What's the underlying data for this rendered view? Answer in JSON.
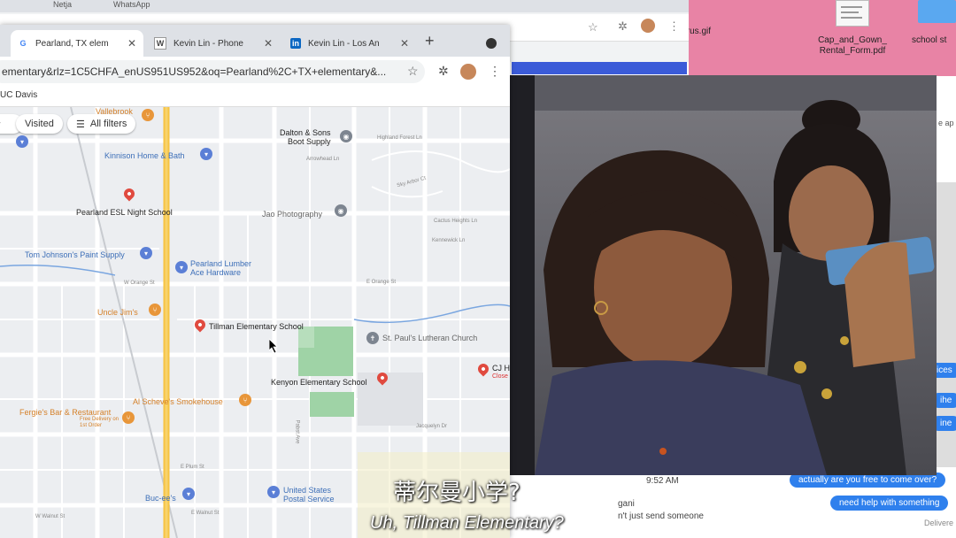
{
  "desktop": {
    "icons": [
      {
        "label_line1": "Cap_and_Gown_",
        "label_line2": "Rental_Form.pdf"
      },
      {
        "label_line1": "school st"
      }
    ],
    "fragment_gif": "airus.gif",
    "pink_color": "#e883a5"
  },
  "back_window": {
    "tabs": [
      "Netja",
      "WhatsApp"
    ],
    "side_text_1": "ne",
    "side_text_2": "e ap"
  },
  "browser": {
    "tabs": [
      {
        "icon": "google-icon",
        "label": "Pearland, TX elem"
      },
      {
        "icon": "w-icon",
        "label": "Kevin Lin - Phone"
      },
      {
        "icon": "linkedin-icon",
        "label": "Kevin Lin - Los An"
      }
    ],
    "new_tab": "+",
    "url": "ementary&rlz=1C5CHFA_enUS951US952&oq=Pearland%2C+TX+elementary&...",
    "bookmark": "UC Davis"
  },
  "map": {
    "chips": [
      "Visited",
      "All filters"
    ],
    "pois": {
      "vallebrook": "Vallebrook",
      "dalton": "Dalton & Sons\nBoot Supply",
      "kinnison": "Kinnison Home & Bath",
      "esl": "Pearland ESL Night School",
      "jao": "Jao Photography",
      "tom": "Tom Johnson's Paint Supply",
      "lumber": "Pearland Lumber\nAce Hardware",
      "uncle": "Uncle Jim's",
      "tillman": "Tillman Elementary School",
      "stpauls": "St. Paul's Lutheran Church",
      "kenyon": "Kenyon Elementary School",
      "cj": "CJ H",
      "cj_status": "Close",
      "scheve": "Al Scheve's Smokehouse",
      "fergie": "Fergie's Bar & Restaurant",
      "fergie_sub": "Free Delivery on\n1st Order",
      "bucees": "Buc-ee's",
      "usps": "United States\nPostal Service"
    },
    "streets": [
      "Highland Forest Ln",
      "Arrowhead Ln",
      "Sky Arbor Ct",
      "Cactus Heights Ln",
      "Kennewick Ln",
      "E Orange St",
      "W Orange St",
      "E Plum St",
      "E Walnut St",
      "W Walnut St",
      "Jacquelyn Dr",
      "Pabst Ave",
      "E Plum St"
    ]
  },
  "messages": {
    "bubbles": [
      "actually are you free to come over?",
      "need help with something"
    ],
    "time": "9:52 AM",
    "name": "gani",
    "preview": "n't just send someone",
    "delivered": "Delivere",
    "partial_bubbles": [
      "ices",
      "ihe",
      "ine"
    ]
  },
  "subtitles": {
    "chinese": "蒂尔曼小学?",
    "english": "Uh, Tillman Elementary?"
  },
  "colors": {
    "map_bg": "#eceef1",
    "road_yellow": "#f6c343",
    "park_green": "#9fd3a6",
    "pin_red": "#e04a3f",
    "pin_blue": "#5b7fd6",
    "pin_orange": "#e8963a",
    "imessage_blue": "#2f80ed"
  }
}
